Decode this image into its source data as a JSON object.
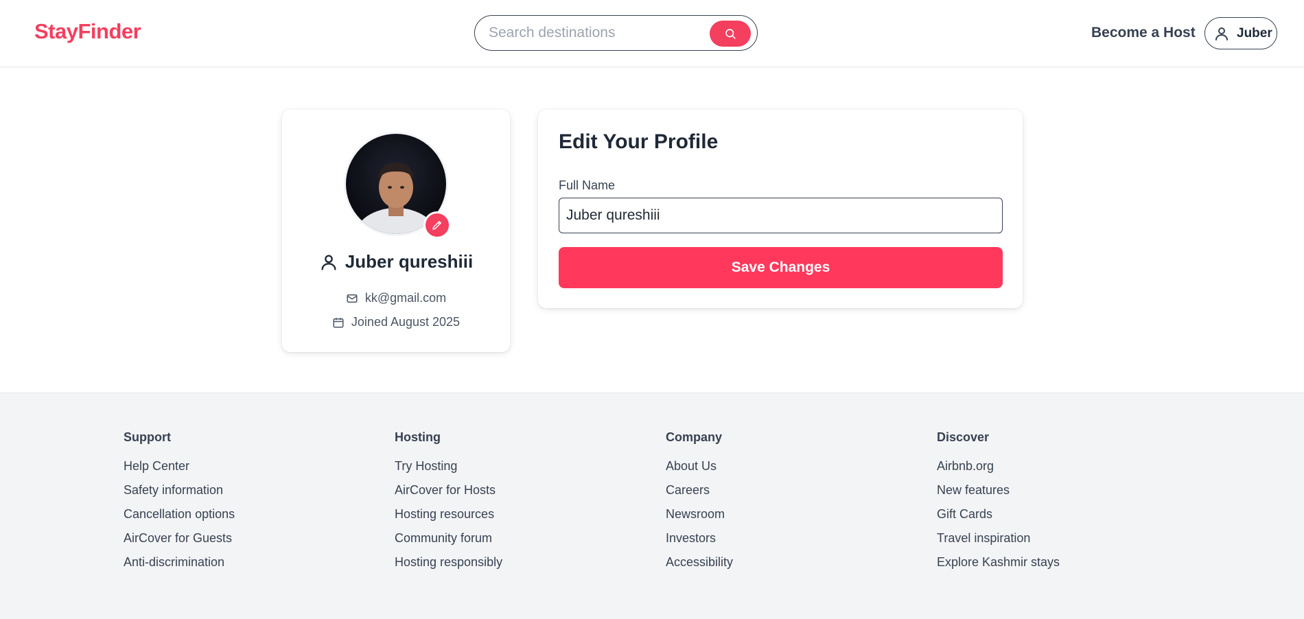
{
  "brand": {
    "name": "StayFinder",
    "color": "#f43f5e"
  },
  "header": {
    "search_placeholder": "Search destinations",
    "search_icon": "search-icon",
    "become_host": "Become a Host",
    "user_label": "Juber",
    "user_icon": "user-icon"
  },
  "profile": {
    "name": "Juber qureshiii",
    "email": "kk@gmail.com",
    "joined": "Joined August 2025",
    "icons": [
      "user-icon",
      "mail-icon",
      "calendar-icon",
      "pencil-icon"
    ]
  },
  "edit": {
    "title": "Edit Your Profile",
    "full_name_label": "Full Name",
    "full_name_value": "Juber qureshiii",
    "save_label": "Save Changes",
    "accent": "#ff385c"
  },
  "footer": {
    "columns": [
      {
        "heading": "Support",
        "links": [
          "Help Center",
          "Safety information",
          "Cancellation options",
          "AirCover for Guests",
          "Anti-discrimination"
        ]
      },
      {
        "heading": "Hosting",
        "links": [
          "Try Hosting",
          "AirCover for Hosts",
          "Hosting resources",
          "Community forum",
          "Hosting responsibly"
        ]
      },
      {
        "heading": "Company",
        "links": [
          "About Us",
          "Careers",
          "Newsroom",
          "Investors",
          "Accessibility"
        ]
      },
      {
        "heading": "Discover",
        "links": [
          "Airbnb.org",
          "New features",
          "Gift Cards",
          "Travel inspiration",
          "Explore Kashmir stays"
        ]
      }
    ]
  }
}
